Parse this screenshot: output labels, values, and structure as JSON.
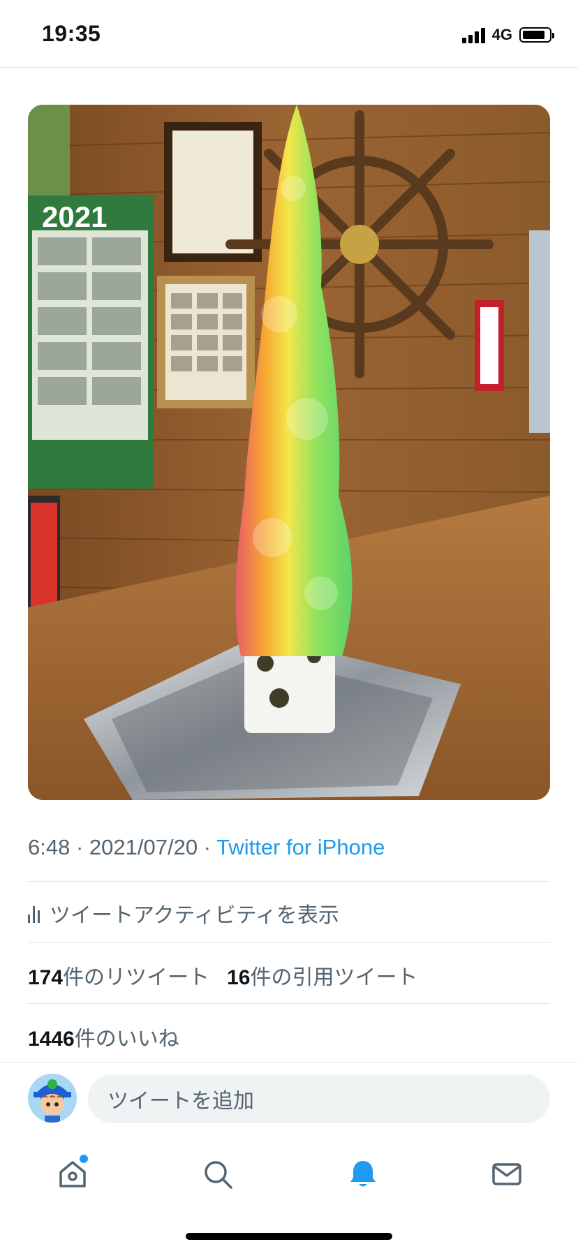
{
  "status_bar": {
    "time": "19:35",
    "network": "4G",
    "battery_level": 0.85
  },
  "tweet": {
    "media": {
      "icon": "photo",
      "description_icons": [
        "shave-ice-icon"
      ]
    },
    "time": "6:48",
    "separator": "·",
    "date": "2021/07/20",
    "source": "Twitter for iPhone",
    "activity_label": "ツイートアクティビティを表示",
    "retweets": {
      "count": "174",
      "label": "件のリツイート"
    },
    "quotes": {
      "count": "16",
      "label": "件の引用ツイート"
    },
    "likes": {
      "count": "1446",
      "label": "件のいいね"
    }
  },
  "reply": {
    "placeholder": "ツイートを追加"
  },
  "tab_bar": {
    "items": [
      {
        "name": "home",
        "icon": "home-icon",
        "has_dot": true
      },
      {
        "name": "search",
        "icon": "search-icon"
      },
      {
        "name": "notifications",
        "icon": "bell-icon",
        "active": true
      },
      {
        "name": "messages",
        "icon": "mail-icon"
      }
    ]
  },
  "colors": {
    "accent": "#1d9bf0",
    "secondary_text": "#536471"
  }
}
